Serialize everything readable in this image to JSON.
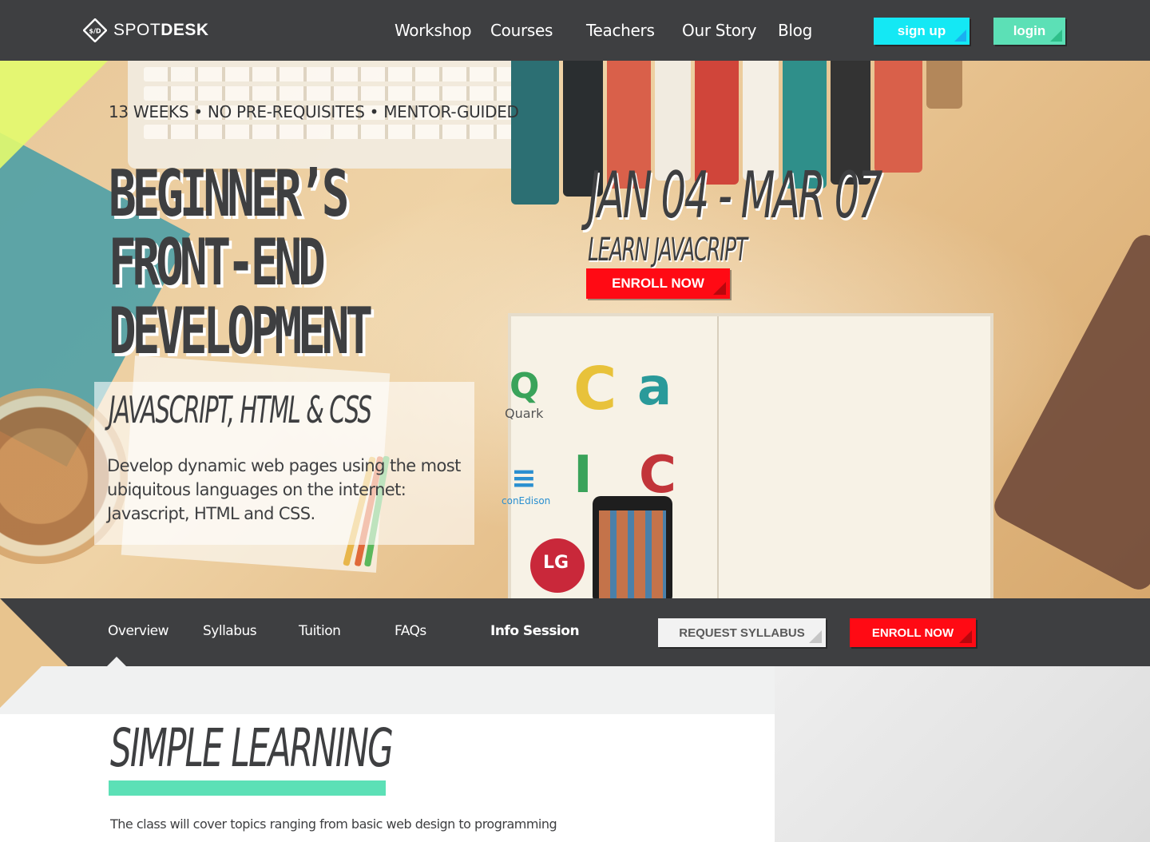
{
  "brand": {
    "logo_mark": "$/D",
    "name_light": "SPOT",
    "name_bold": "DESK"
  },
  "nav": {
    "links": [
      "Workshop",
      "Courses",
      "Teachers",
      "Our Story",
      "Blog"
    ],
    "signup_label": "sign up",
    "login_label": "login"
  },
  "hero": {
    "meta": "13 WEEKS • NO PRE-REQUISITES • MENTOR-GUIDED",
    "title_lines": [
      "BEGINNER’S",
      "FRONT-END",
      "DEVELOPMENT"
    ],
    "subtitle": "JAVASCRIPT, HTML & CSS",
    "description": "Develop dynamic web pages using the most ubiquitous languages on the internet: Javascript, HTML and CSS.",
    "dates": "JAN 04 - MAR 07",
    "learn": "LEARN JAVACRIPT",
    "enroll_label": "ENROLL NOW",
    "photo_logos": [
      "Quark",
      "conEdison",
      "LG"
    ]
  },
  "subnav": {
    "links": [
      "Overview",
      "Syllabus",
      "Tuition",
      "FAQs",
      "Info Session"
    ],
    "active": "Overview",
    "request_label": "REQUEST SYLLABUS",
    "enroll_label": "ENROLL NOW"
  },
  "section": {
    "title": "SIMPLE LEARNING",
    "text": "The class will cover topics ranging from basic web design to programming"
  },
  "colors": {
    "dark": "#3e3f41",
    "cyan": "#14e8f4",
    "mint": "#5ce0b6",
    "red": "#ff0a14",
    "lime": "#e3fb6e"
  },
  "icons": [
    "logo-diamond-icon",
    "fold-corner-icon"
  ]
}
